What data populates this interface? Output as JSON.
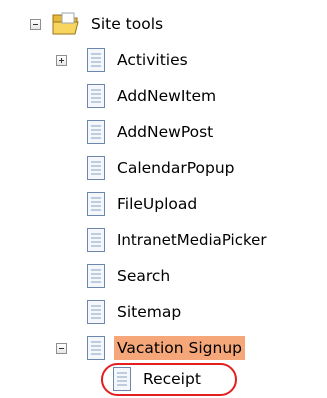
{
  "tree": {
    "root": {
      "label": "Site tools",
      "icon": "folder-open-icon",
      "toggle": "collapse"
    },
    "items": [
      {
        "label": "Activities",
        "icon": "page-icon",
        "toggle": "expand"
      },
      {
        "label": "AddNewItem",
        "icon": "page-icon"
      },
      {
        "label": "AddNewPost",
        "icon": "page-icon"
      },
      {
        "label": "CalendarPopup",
        "icon": "page-icon"
      },
      {
        "label": "FileUpload",
        "icon": "page-icon"
      },
      {
        "label": "IntranetMediaPicker",
        "icon": "page-icon"
      },
      {
        "label": "Search",
        "icon": "page-icon"
      },
      {
        "label": "Sitemap",
        "icon": "page-icon"
      },
      {
        "label": "Vacation Signup",
        "icon": "page-icon",
        "toggle": "collapse",
        "selected": true
      }
    ],
    "child": {
      "label": "Receipt",
      "icon": "page-icon"
    }
  },
  "colors": {
    "selection": "#f5a77a",
    "highlight_ring": "#e41f1f"
  }
}
